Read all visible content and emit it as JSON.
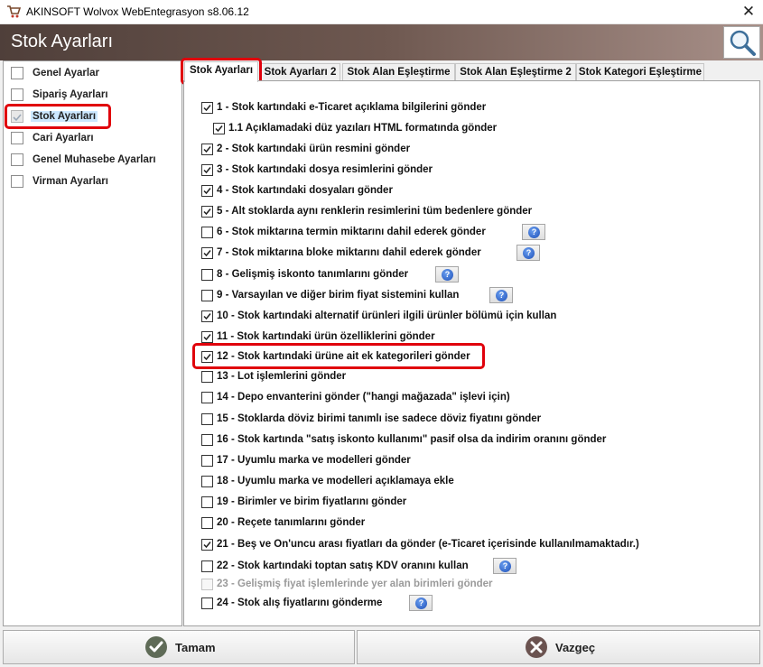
{
  "window": {
    "title": "AKINSOFT Wolvox WebEntegrasyon s8.06.12",
    "close_glyph": "✕"
  },
  "header": {
    "title": "Stok Ayarları",
    "search_icon": "search-icon"
  },
  "sidebar": {
    "items": [
      {
        "label": "Genel Ayarlar"
      },
      {
        "label": "Sipariş Ayarları"
      },
      {
        "label": "Stok Ayarları"
      },
      {
        "label": "Cari Ayarları"
      },
      {
        "label": "Genel Muhasebe Ayarları"
      },
      {
        "label": "Virman Ayarları"
      }
    ],
    "active_index": 2
  },
  "tabs": [
    {
      "label": "Stok Ayarları"
    },
    {
      "label": "Stok Ayarları 2"
    },
    {
      "label": "Stok Alan Eşleştirme"
    },
    {
      "label": "Stok Alan Eşleştirme 2"
    },
    {
      "label": "Stok Kategori Eşleştirme"
    }
  ],
  "options": [
    {
      "label": "1 - Stok kartındaki e-Ticaret açıklama bilgilerini gönder",
      "checked": true
    },
    {
      "label": "1.1 Açıklamadaki düz yazıları HTML formatında gönder",
      "checked": true
    },
    {
      "label": "2 - Stok kartındaki ürün resmini gönder",
      "checked": true
    },
    {
      "label": "3 - Stok kartındaki dosya resimlerini gönder",
      "checked": true
    },
    {
      "label": "4 - Stok kartındaki dosyaları gönder",
      "checked": true
    },
    {
      "label": "5 - Alt stoklarda aynı renklerin resimlerini tüm bedenlere gönder",
      "checked": true
    },
    {
      "label": "6 - Stok miktarına termin miktarını dahil ederek gönder",
      "checked": false
    },
    {
      "label": "7 - Stok miktarına bloke miktarını dahil ederek gönder",
      "checked": true
    },
    {
      "label": "8 - Gelişmiş iskonto tanımlarını gönder",
      "checked": false
    },
    {
      "label": "9 - Varsayılan ve diğer birim fiyat sistemini kullan",
      "checked": false
    },
    {
      "label": "10 - Stok kartındaki alternatif ürünleri ilgili ürünler bölümü için kullan",
      "checked": true
    },
    {
      "label": "11 - Stok kartındaki ürün özelliklerini gönder",
      "checked": true
    },
    {
      "label": "12 - Stok kartındaki ürüne ait ek kategorileri gönder",
      "checked": true
    },
    {
      "label": "13 - Lot işlemlerini gönder",
      "checked": false
    },
    {
      "label": "14 - Depo envanterini gönder (\"hangi mağazada\" işlevi için)",
      "checked": false
    },
    {
      "label": "15 - Stoklarda döviz birimi tanımlı ise sadece döviz fiyatını gönder",
      "checked": false
    },
    {
      "label": "16 - Stok kartında \"satış iskonto kullanımı\" pasif olsa da indirim oranını gönder",
      "checked": false
    },
    {
      "label": "17 - Uyumlu marka ve modelleri gönder",
      "checked": false
    },
    {
      "label": "18 - Uyumlu marka ve modelleri açıklamaya ekle",
      "checked": false
    },
    {
      "label": "19 - Birimler ve birim fiyatlarını gönder",
      "checked": false
    },
    {
      "label": "20 - Reçete tanımlarını gönder",
      "checked": false
    },
    {
      "label": "21 - Beş ve On'uncu arası fiyatları da gönder (e-Ticaret içerisinde kullanılmamaktadır.)",
      "checked": true
    },
    {
      "label": "22 - Stok kartındaki toptan satış KDV oranını kullan",
      "checked": false
    },
    {
      "label": "23 - Gelişmiş fiyat işlemlerinde yer alan birimleri gönder",
      "checked": false,
      "disabled": true
    },
    {
      "label": "24 - Stok alış fiyatlarını gönderme",
      "checked": false
    }
  ],
  "help_icon": "help-question-icon",
  "buttons": {
    "ok_label": "Tamam",
    "cancel_label": "Vazgeç"
  },
  "colors": {
    "highlight": "#e0000b",
    "header_dark": "#4f3f3a",
    "ok_green": "#5f6b57",
    "cancel_red": "#6b5350"
  }
}
